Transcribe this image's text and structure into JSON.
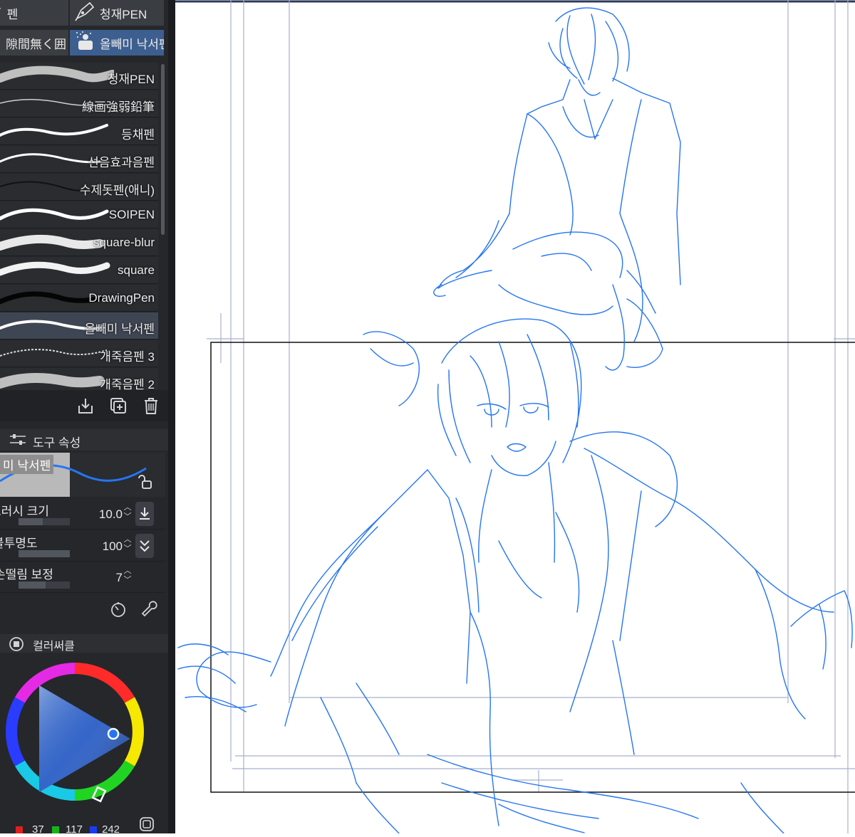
{
  "tabs": [
    {
      "label": "펜",
      "active": false
    },
    {
      "label": "청재PEN",
      "active": false
    },
    {
      "label": "隙間無く囲",
      "active": false
    },
    {
      "label": "올빼미 낙서펜",
      "active": true
    }
  ],
  "brushes": [
    {
      "label": "청재PEN",
      "selected": false
    },
    {
      "label": "線画強弱鉛筆",
      "selected": false
    },
    {
      "label": "등채펜",
      "selected": false
    },
    {
      "label": "선음효과음펜",
      "selected": false
    },
    {
      "label": "수제돗펜(애니)",
      "selected": false
    },
    {
      "label": "SOIPEN",
      "selected": false
    },
    {
      "label": "square-blur",
      "selected": false
    },
    {
      "label": "square",
      "selected": false
    },
    {
      "label": "DrawingPen",
      "selected": false
    },
    {
      "label": "올빼미 낙서펜",
      "selected": true
    },
    {
      "label": "개죽음펜 3",
      "selected": false
    },
    {
      "label": "개죽음펜 2",
      "selected": false
    }
  ],
  "tool_property": {
    "title": "도구 속성",
    "preview_name": "미 낙서펜",
    "brush_size": {
      "label": "브러시 크기",
      "value": "10.0"
    },
    "opacity": {
      "label": "불투명도",
      "value": "100"
    },
    "stabilization": {
      "label": "손떨림 보정",
      "value": "7"
    }
  },
  "color_circle": {
    "title": "컬러써클",
    "r": "37",
    "g": "117",
    "b": "242",
    "current_color": "#2575f2"
  },
  "colors": {
    "panel_bg": "#25272b",
    "accent": "#3d5f8f",
    "sketch_line": "#2575f2"
  }
}
